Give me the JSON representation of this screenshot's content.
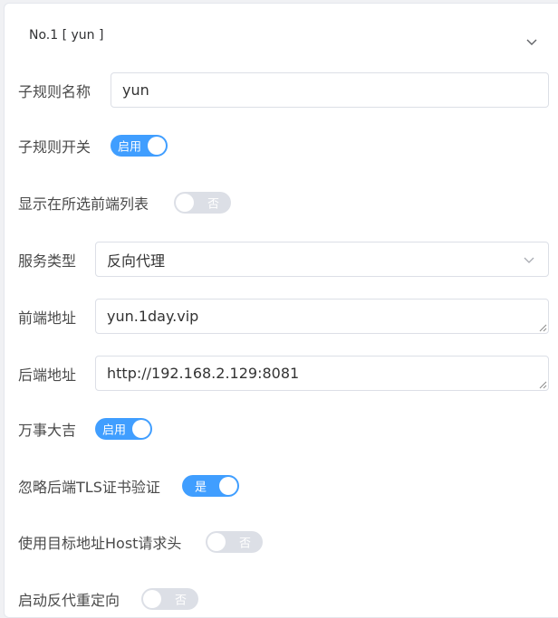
{
  "rule": {
    "header_title": "No.1 [ yun ]",
    "icons": {
      "collapse": "chevron-down-icon",
      "select": "chevron-down-icon",
      "resize": "resize-handle-icon"
    }
  },
  "fields": {
    "name": {
      "label": "子规则名称",
      "value": "yun"
    },
    "enabled": {
      "label": "子规则开关",
      "state": "启用"
    },
    "show_frontend": {
      "label": "显示在所选前端列表",
      "state": "否"
    },
    "service_type": {
      "label": "服务类型",
      "value": "反向代理"
    },
    "frontend_addr": {
      "label": "前端地址",
      "value": "yun.1day.vip"
    },
    "backend_addr": {
      "label": "后端地址",
      "value": "http://192.168.2.129:8081"
    },
    "lucky": {
      "label": "万事大吉",
      "state": "启用"
    },
    "ignore_tls": {
      "label": "忽略后端TLS证书验证",
      "state": "是"
    },
    "use_host_header": {
      "label": "使用目标地址Host请求头",
      "state": "否"
    },
    "auto_redirect": {
      "label": "启动反代重定向",
      "state": "否"
    }
  },
  "colors": {
    "switch_on": "#409eff",
    "switch_off": "#dcdfe6",
    "border": "#dcdfe6"
  }
}
